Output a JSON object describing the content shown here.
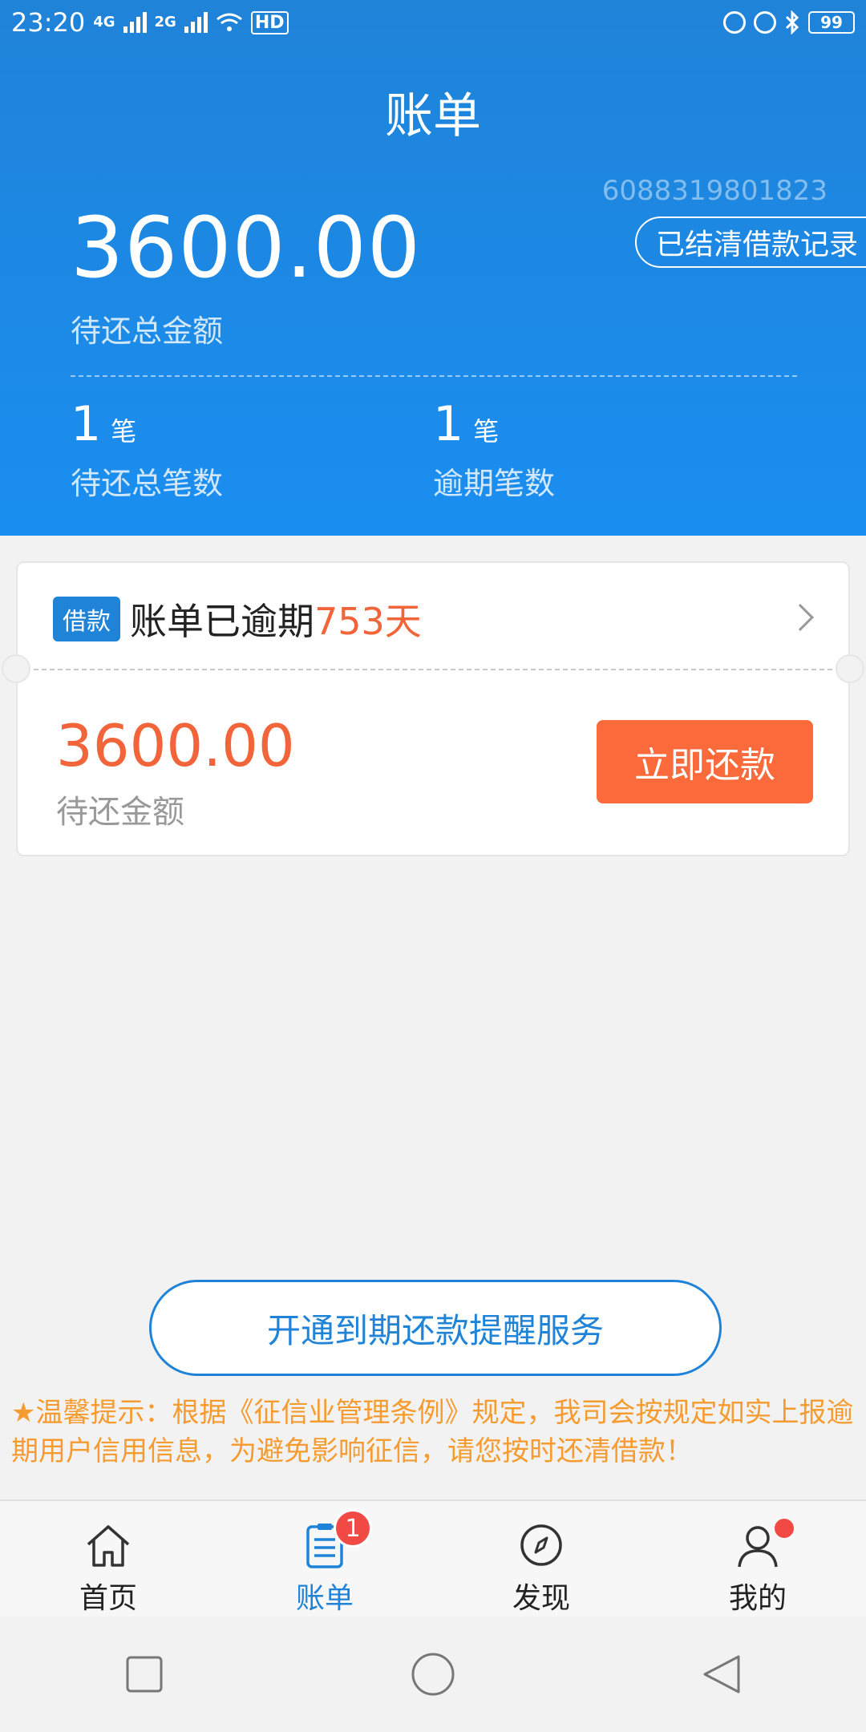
{
  "status_bar": {
    "time": "23:20",
    "net1": "4G",
    "net2": "2G",
    "hd": "HD",
    "battery": "99"
  },
  "header": {
    "title": "账单",
    "account_number": "6088319801823",
    "history_button": "已结清借款记录",
    "total_amount": "3600.00",
    "total_label": "待还总金额",
    "stats": [
      {
        "count": "1",
        "unit": "笔",
        "label": "待还总笔数"
      },
      {
        "count": "1",
        "unit": "笔",
        "label": "逾期笔数"
      }
    ]
  },
  "bill_card": {
    "tag": "借款",
    "title_prefix": "账单已逾期",
    "overdue_days": "753天",
    "amount": "3600.00",
    "amount_label": "待还金额",
    "pay_button": "立即还款"
  },
  "reminder_button": "开通到期还款提醒服务",
  "tip_text": "★温馨提示：根据《征信业管理条例》规定，我司会按规定如实上报逾期用户信用信息，为避免影响征信，请您按时还清借款！",
  "tabs": [
    {
      "label": "首页",
      "icon": "home-icon"
    },
    {
      "label": "账单",
      "icon": "bill-icon",
      "badge": "1"
    },
    {
      "label": "发现",
      "icon": "compass-icon"
    },
    {
      "label": "我的",
      "icon": "user-icon"
    }
  ],
  "colors": {
    "primary": "#1f83d8",
    "accent": "#fb6a3a",
    "warning_text": "#f59b2f"
  }
}
